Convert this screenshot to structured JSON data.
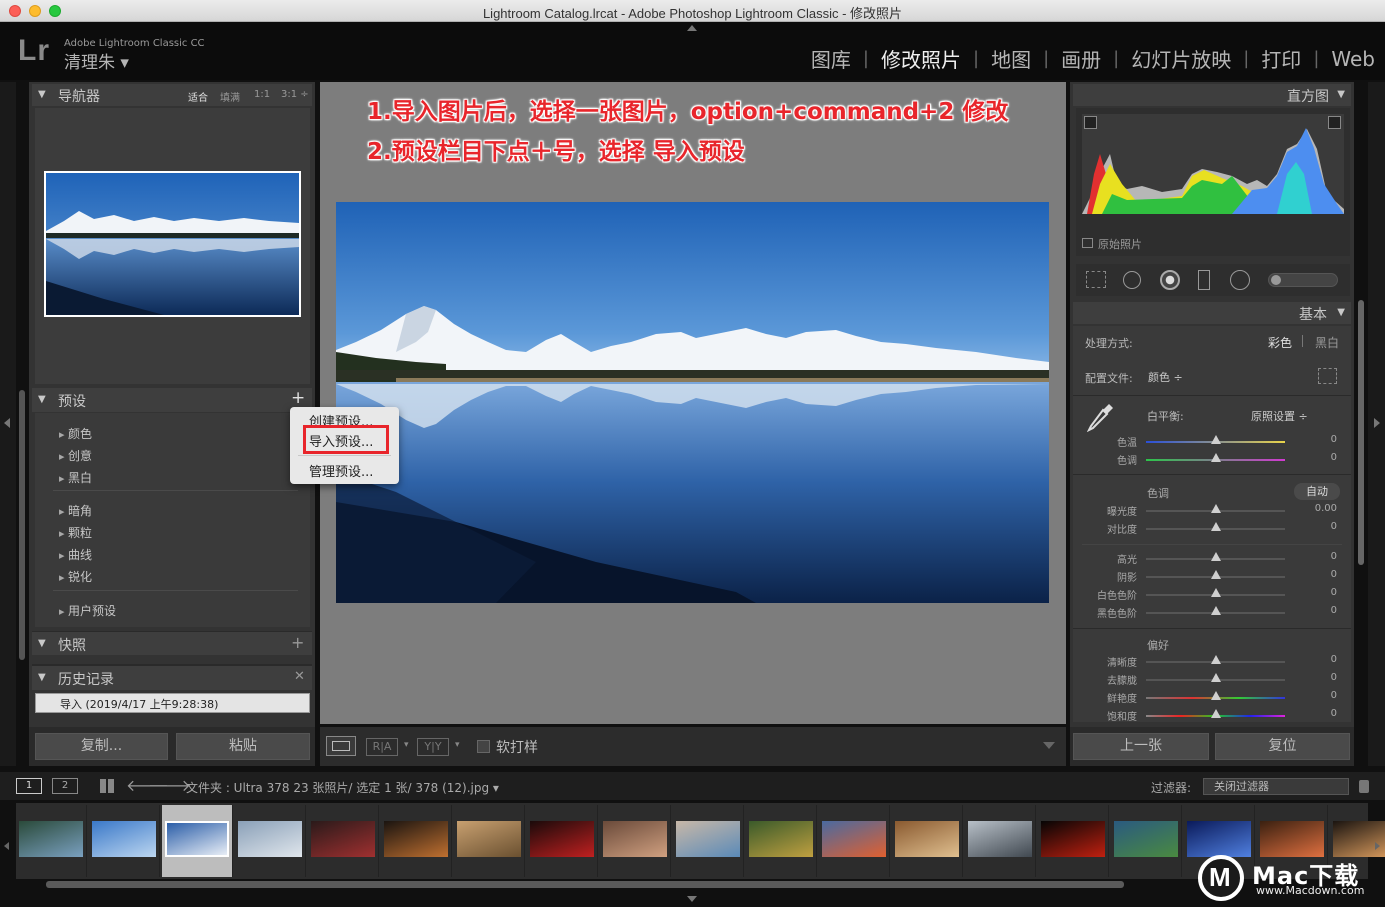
{
  "window": {
    "title": "Lightroom Catalog.lrcat - Adobe Photoshop Lightroom Classic - 修改照片"
  },
  "identity": {
    "logo": "Lr",
    "product": "Adobe Lightroom Classic CC",
    "user": "清理朱 ▾"
  },
  "modules": [
    "图库",
    "修改照片",
    "地图",
    "画册",
    "幻灯片放映",
    "打印",
    "Web"
  ],
  "navigator": {
    "title": "导航器",
    "zoom_options": [
      "适合",
      "填满",
      "1:1",
      "3:1 ÷"
    ]
  },
  "presets": {
    "title": "预设",
    "groups1": [
      "颜色",
      "创意",
      "黑白"
    ],
    "groups2": [
      "暗角",
      "颗粒",
      "曲线",
      "锐化"
    ],
    "groups3": [
      "用户预设"
    ]
  },
  "context_menu": {
    "items": [
      "创建预设...",
      "导入预设...",
      "管理预设..."
    ]
  },
  "snapshots": {
    "title": "快照"
  },
  "history": {
    "title": "历史记录",
    "entry": "导入 (2019/4/17 上午9:28:38)"
  },
  "left_buttons": {
    "copy": "复制...",
    "paste": "粘贴"
  },
  "annotation": {
    "line1": "1.导入图片后，选择一张图片，option+command+2 修改",
    "line2": "2.预设栏目下点＋号，选择 导入预设"
  },
  "toolbar": {
    "proof": "软打样"
  },
  "histogram": {
    "title": "直方图",
    "original": "原始照片"
  },
  "basic": {
    "title": "基本",
    "treatment_label": "处理方式:",
    "color": "彩色",
    "bw": "黑白",
    "profile_label": "配置文件:",
    "profile_value": "颜色 ÷",
    "wb_label": "白平衡:",
    "wb_value": "原照设置 ÷",
    "tone_label": "色调",
    "auto": "自动",
    "presence_label": "偏好"
  },
  "sliders": {
    "wb": [
      {
        "label": "色温",
        "value": "0"
      },
      {
        "label": "色调",
        "value": "0"
      }
    ],
    "tone1": [
      {
        "label": "曝光度",
        "value": "0.00"
      },
      {
        "label": "对比度",
        "value": "0"
      }
    ],
    "tone2": [
      {
        "label": "高光",
        "value": "0"
      },
      {
        "label": "阴影",
        "value": "0"
      },
      {
        "label": "白色色阶",
        "value": "0"
      },
      {
        "label": "黑色色阶",
        "value": "0"
      }
    ],
    "presence": [
      {
        "label": "清晰度",
        "value": "0"
      },
      {
        "label": "去朦胧",
        "value": "0"
      },
      {
        "label": "鲜艳度",
        "value": "0"
      },
      {
        "label": "饱和度",
        "value": "0"
      }
    ]
  },
  "right_buttons": {
    "prev": "上一张",
    "reset": "复位"
  },
  "filmstrip": {
    "view1": "1",
    "view2": "2",
    "folder_info": "文件夹 : Ultra 378   23 张照片/ 选定 1 张/ 378 (12).jpg ▾",
    "filter_label": "过滤器:",
    "filter_value": "关闭过滤器"
  },
  "watermark": {
    "brand": "Mac下载",
    "url": "www.Macdown.com"
  },
  "colors": {
    "accent_red": "#e8252b",
    "panel": "#3a3a3a",
    "photo_sky": "#3d7fc8"
  }
}
